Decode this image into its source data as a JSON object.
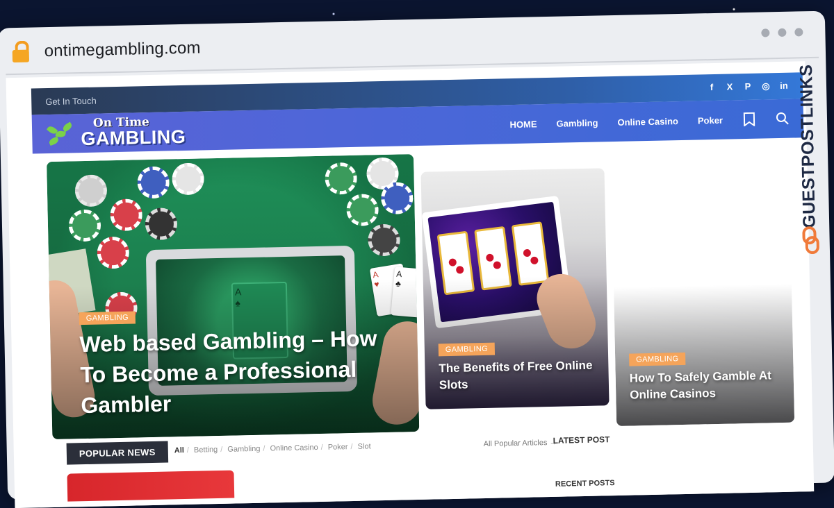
{
  "browser": {
    "url": "ontimegambling.com"
  },
  "watermark": {
    "text": "GUESTPOSTLINKS"
  },
  "site": {
    "topbar": {
      "contact": "Get In Touch"
    },
    "social": [
      {
        "name": "facebook-icon",
        "glyph": "f"
      },
      {
        "name": "x-icon",
        "glyph": "X"
      },
      {
        "name": "pinterest-icon",
        "glyph": "P"
      },
      {
        "name": "instagram-icon",
        "glyph": "◎"
      },
      {
        "name": "linkedin-icon",
        "glyph": "in"
      }
    ],
    "logo": {
      "line1": "On Time",
      "line2": "GAMBLING"
    },
    "nav": {
      "items": [
        "HOME",
        "Gambling",
        "Online Casino",
        "Poker"
      ],
      "bookmark_count": "0"
    }
  },
  "featured": [
    {
      "category": "GAMBLING",
      "title": "Web based Gambling – How To Become a Professional Gambler"
    },
    {
      "category": "GAMBLING",
      "title": "The Benefits of Free Online Slots"
    },
    {
      "category": "GAMBLING",
      "title": "How To Safely Gamble At Online Casinos"
    }
  ],
  "popular": {
    "heading": "POPULAR NEWS",
    "filters": [
      "All",
      "Betting",
      "Gambling",
      "Online Casino",
      "Poker",
      "Slot"
    ],
    "link": "All Popular Articles →",
    "latest_heading": "LATEST POST",
    "recent_heading": "RECENT POSTS"
  },
  "colors": {
    "accent_tag": "#f5a45a",
    "header_gradient_start": "#5a63d6",
    "header_gradient_end": "#3a6ad6"
  }
}
